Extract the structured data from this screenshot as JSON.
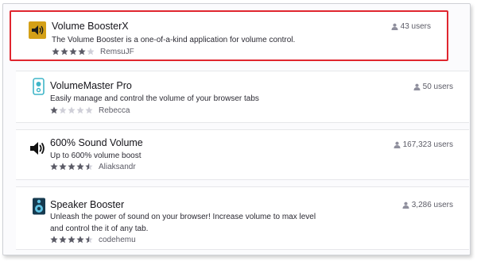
{
  "addons": [
    {
      "name": "Volume BoosterX",
      "description": "The Volume Booster is a one-of-a-kind application for volume control.",
      "author": "RemsuJF",
      "rating": 4,
      "users": "43 users",
      "icon": "speaker-volume-icon",
      "highlighted": true
    },
    {
      "name": "VolumeMaster Pro",
      "description": "Easily manage and control the volume of your browser tabs",
      "author": "Rebecca",
      "rating": 1,
      "users": "50 users",
      "icon": "speaker-device-icon",
      "highlighted": false
    },
    {
      "name": "600% Sound Volume",
      "description": "Up to 600% volume boost",
      "author": "Aliaksandr",
      "rating": 4.5,
      "users": "167,323 users",
      "icon": "sound-on-icon",
      "highlighted": false
    },
    {
      "name": "Speaker Booster",
      "description": "Unleash the power of sound on your browser! Increase volume to max level and control the it of any tab.",
      "author": "codehemu",
      "rating": 4.5,
      "users": "3,286 users",
      "icon": "loudspeaker-icon",
      "highlighted": false
    }
  ],
  "colors": {
    "highlight_border": "#e0262f",
    "star_filled": "#5b5b66",
    "star_empty": "#cfcfd8",
    "title": "#15141a"
  }
}
